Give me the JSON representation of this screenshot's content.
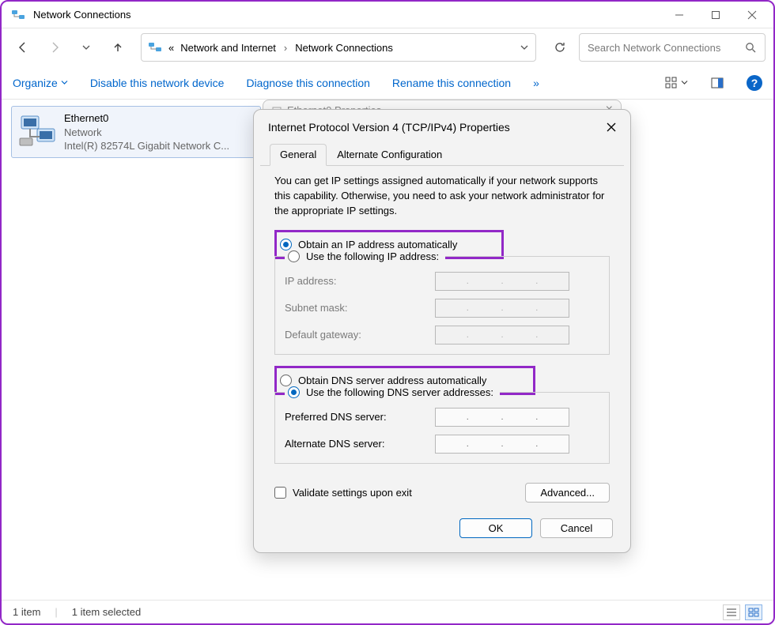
{
  "window": {
    "title": "Network Connections"
  },
  "breadcrumb": {
    "prefix": "«",
    "seg1": "Network and Internet",
    "seg2": "Network Connections"
  },
  "search": {
    "placeholder": "Search Network Connections"
  },
  "commands": {
    "organize": "Organize",
    "disable": "Disable this network device",
    "diagnose": "Diagnose this connection",
    "rename": "Rename this connection",
    "overflow": "»"
  },
  "adapter": {
    "name": "Ethernet0",
    "status": "Network",
    "device": "Intel(R) 82574L Gigabit Network C..."
  },
  "peek": {
    "title": "Ethernet0 Properties",
    "close": "×"
  },
  "dialog": {
    "title": "Internet Protocol Version 4 (TCP/IPv4) Properties",
    "tabs": {
      "general": "General",
      "alt": "Alternate Configuration"
    },
    "description": "You can get IP settings assigned automatically if your network supports this capability. Otherwise, you need to ask your network administrator for the appropriate IP settings.",
    "ip": {
      "auto": "Obtain an IP address automatically",
      "manual": "Use the following IP address:",
      "addr": "IP address:",
      "mask": "Subnet mask:",
      "gw": "Default gateway:"
    },
    "dns": {
      "auto": "Obtain DNS server address automatically",
      "manual": "Use the following DNS server addresses:",
      "pref": "Preferred DNS server:",
      "alt": "Alternate DNS server:"
    },
    "validate": "Validate settings upon exit",
    "advanced": "Advanced...",
    "ok": "OK",
    "cancel": "Cancel"
  },
  "status": {
    "count": "1 item",
    "selected": "1 item selected"
  }
}
